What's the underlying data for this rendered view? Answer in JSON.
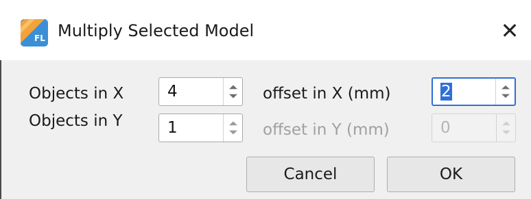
{
  "dialog": {
    "title": "Multiply Selected Model",
    "close_glyph": "✕",
    "app_icon": "fl-app-icon",
    "accent": "#2f6fd8"
  },
  "fields": {
    "objects_x": {
      "label": "Objects in X",
      "value": "4",
      "enabled": true
    },
    "objects_y": {
      "label": "Objects in Y",
      "value": "1",
      "enabled": true
    },
    "offset_x": {
      "label": "offset in X (mm)",
      "value": "2",
      "enabled": true,
      "focused": true,
      "selected": true
    },
    "offset_y": {
      "label": "offset in Y (mm)",
      "value": "0",
      "enabled": false
    }
  },
  "buttons": {
    "cancel": "Cancel",
    "ok": "OK"
  }
}
